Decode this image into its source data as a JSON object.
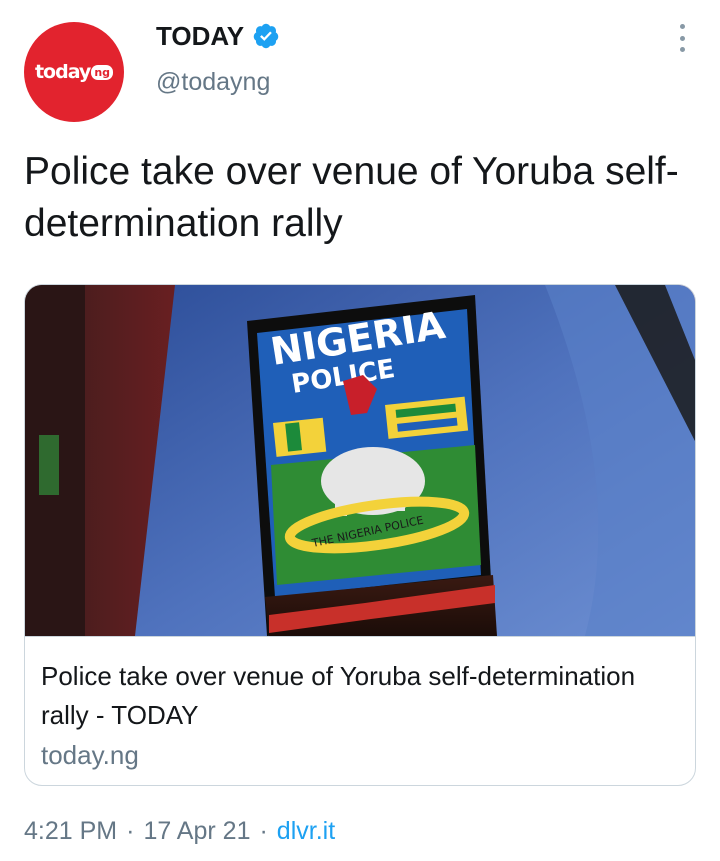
{
  "account": {
    "avatar_text": "today",
    "avatar_suffix": "ng",
    "display_name": "TODAY",
    "verified": true,
    "handle": "@todayng"
  },
  "tweet": {
    "text": "Police take over venue of Yoruba self-determination rally"
  },
  "card": {
    "image_badge": {
      "line1": "NIGERIA",
      "line2": "POLICE",
      "ribbon": "THE NIGERIA POLICE"
    },
    "title": "Police take over venue of Yoruba self-determination rally - TODAY",
    "domain": "today.ng"
  },
  "meta": {
    "time": "4:21 PM",
    "date": "17 Apr 21",
    "separator": "·",
    "source": "dlvr.it"
  },
  "colors": {
    "brand_red": "#e2232e",
    "verified_blue": "#1da1f2",
    "secondary_text": "#657786",
    "link": "#1da1f2"
  },
  "icons": [
    "verified-badge-icon",
    "more-options-icon"
  ]
}
